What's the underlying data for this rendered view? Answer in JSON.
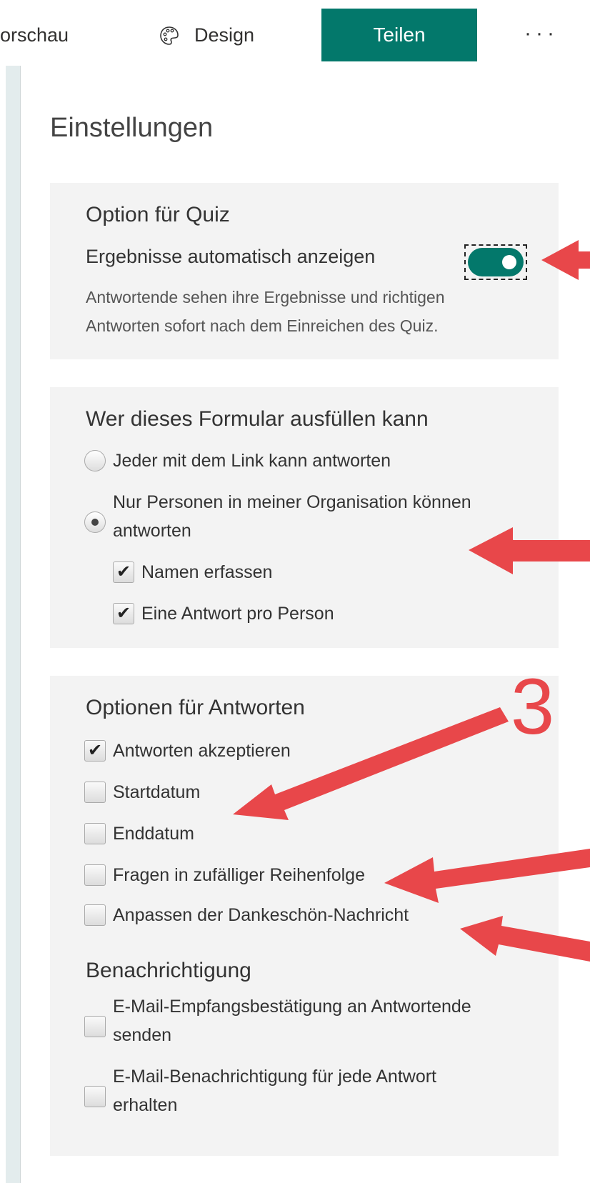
{
  "topbar": {
    "vorschau": "orschau",
    "design": "Design",
    "teilen": "Teilen",
    "more": "···"
  },
  "page_title": "Einstellungen",
  "quiz": {
    "heading": "Option für Quiz",
    "toggle_label": "Ergebnisse automatisch anzeigen",
    "toggle_on": true,
    "desc_line1": "Antwortende sehen ihre Ergebnisse und richtigen",
    "desc_line2": "Antworten sofort nach dem Einreichen des Quiz."
  },
  "who": {
    "heading": "Wer dieses Formular ausfüllen kann",
    "opt1": "Jeder mit dem Link kann antworten",
    "opt2_line1": "Nur Personen in meiner Organisation können",
    "opt2_line2": "antworten",
    "sub1": "Namen erfassen",
    "sub2": "Eine Antwort pro Person"
  },
  "responses": {
    "heading": "Optionen für Antworten",
    "items": [
      {
        "label": "Antworten akzeptieren",
        "checked": true
      },
      {
        "label": "Startdatum",
        "checked": false
      },
      {
        "label": "Enddatum",
        "checked": false
      },
      {
        "label": "Fragen in zufälliger Reihenfolge",
        "checked": false
      },
      {
        "label": "Anpassen der Dankeschön-Nachricht",
        "checked": false
      }
    ]
  },
  "notify": {
    "heading": "Benachrichtigung",
    "item1_line1": "E-Mail-Empfangsbestätigung an Antwortende",
    "item1_line2": "senden",
    "item2_line1": "E-Mail-Benachrichtigung für jede Antwort",
    "item2_line2": "erhalten"
  },
  "annotation": {
    "number": "3",
    "arrow_color": "#e8474a"
  },
  "colors": {
    "accent": "#03786b",
    "card_bg": "#f3f3f3"
  },
  "icons": {
    "design": "palette-icon",
    "check": "checkmark-icon"
  },
  "check_glyph": "✔"
}
